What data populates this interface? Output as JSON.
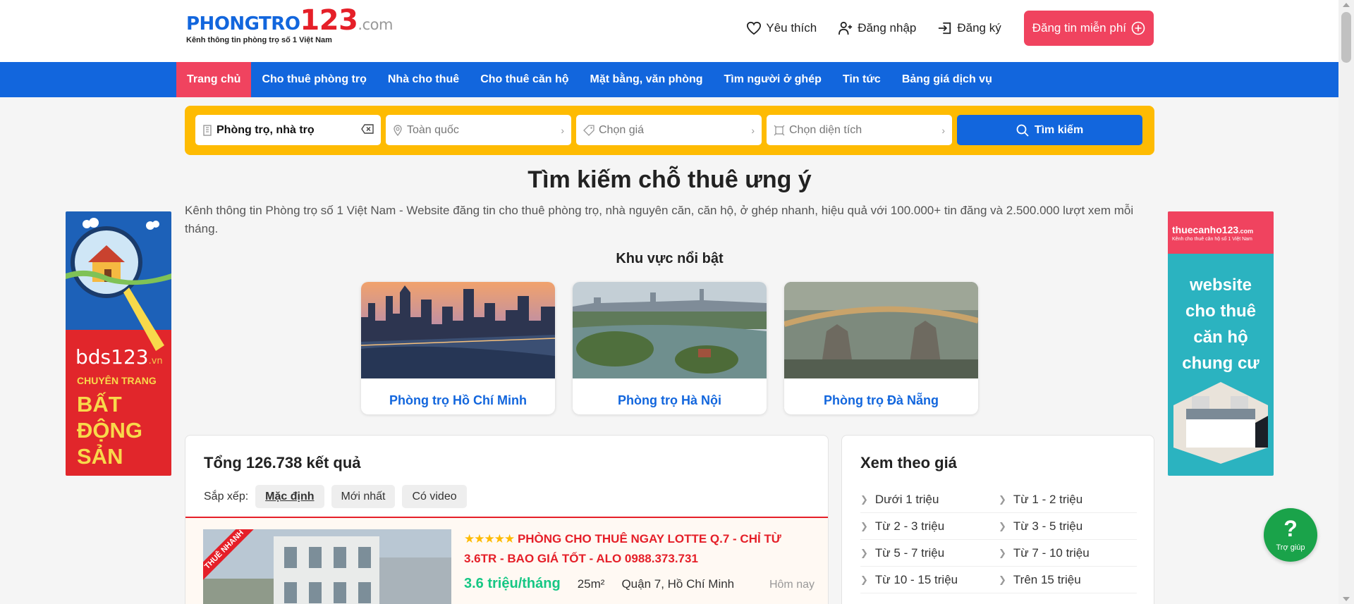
{
  "header": {
    "logo": {
      "main": "PHONGTRO",
      "num": "123",
      "tld": ".com",
      "tagline": "Kênh thông tin phòng trọ số 1 Việt Nam"
    },
    "favorites_label": "Yêu thích",
    "login_label": "Đăng nhập",
    "register_label": "Đăng ký",
    "post_button_label": "Đăng tin miễn phí"
  },
  "nav": {
    "items": [
      {
        "label": "Trang chủ",
        "active": true
      },
      {
        "label": "Cho thuê phòng trọ"
      },
      {
        "label": "Nhà cho thuê"
      },
      {
        "label": "Cho thuê căn hộ"
      },
      {
        "label": "Mặt bằng, văn phòng"
      },
      {
        "label": "Tìm người ở ghép"
      },
      {
        "label": "Tin tức"
      },
      {
        "label": "Bảng giá dịch vụ"
      }
    ]
  },
  "search": {
    "category_value": "Phòng trọ, nhà trọ",
    "location_placeholder": "Toàn quốc",
    "price_placeholder": "Chọn giá",
    "area_placeholder": "Chọn diện tích",
    "submit_label": "Tìm kiếm"
  },
  "hero": {
    "title": "Tìm kiếm chỗ thuê ưng ý",
    "description": "Kênh thông tin Phòng trọ số 1 Việt Nam - Website đăng tin cho thuê phòng trọ, nhà nguyên căn, căn hộ, ở ghép nhanh, hiệu quả với 100.000+ tin đăng và 2.500.000 lượt xem mỗi tháng."
  },
  "featured_areas": {
    "title": "Khu vực nổi bật",
    "cards": [
      {
        "label": "Phòng trọ Hồ Chí Minh"
      },
      {
        "label": "Phòng trọ Hà Nội"
      },
      {
        "label": "Phòng trọ Đà Nẵng"
      }
    ]
  },
  "ads": {
    "left": {
      "brand": "bds123",
      "brand_tld": ".vn",
      "line1": "CHUYÊN TRANG",
      "line2": "BẤT",
      "line3": "ĐỘNG",
      "line4": "SẢN"
    },
    "right": {
      "brand": "thuecanho123",
      "brand_tld": ".com",
      "tagline": "Kênh cho thuê căn hộ số 1 Việt Nam",
      "line1": "website",
      "line2": "cho thuê",
      "line3": "căn hộ",
      "line4": "chung cư"
    }
  },
  "results": {
    "total_label": "Tổng 126.738 kết quả",
    "sort_label": "Sắp xếp:",
    "sort_options": [
      {
        "label": "Mặc định",
        "active": true
      },
      {
        "label": "Mới nhất"
      },
      {
        "label": "Có video"
      }
    ],
    "listing": {
      "ribbon": "THUÊ NHANH",
      "stars": "★★★★★",
      "title": "PHÒNG CHO THUÊ NGAY LOTTE Q.7 - CHỈ TỪ 3.6TR - BAO GIÁ TỐT - ALO 0988.373.731",
      "price": "3.6 triệu/tháng",
      "area": "25m²",
      "location": "Quận 7, Hồ Chí Minh",
      "time": "Hôm nay"
    }
  },
  "price_filter": {
    "title": "Xem theo giá",
    "items": [
      "Dưới 1 triệu",
      "Từ 1 - 2 triệu",
      "Từ 2 - 3 triệu",
      "Từ 3 - 5 triệu",
      "Từ 5 - 7 triệu",
      "Từ 7 - 10 triệu",
      "Từ 10 - 15 triệu",
      "Trên 15 triệu"
    ]
  },
  "help": {
    "symbol": "?",
    "label": "Trợ giúp"
  },
  "colors": {
    "primary": "#1266dd",
    "accent": "#f0435f",
    "search_bg": "#febb02",
    "price": "#16c784",
    "help": "#1aa34a"
  }
}
